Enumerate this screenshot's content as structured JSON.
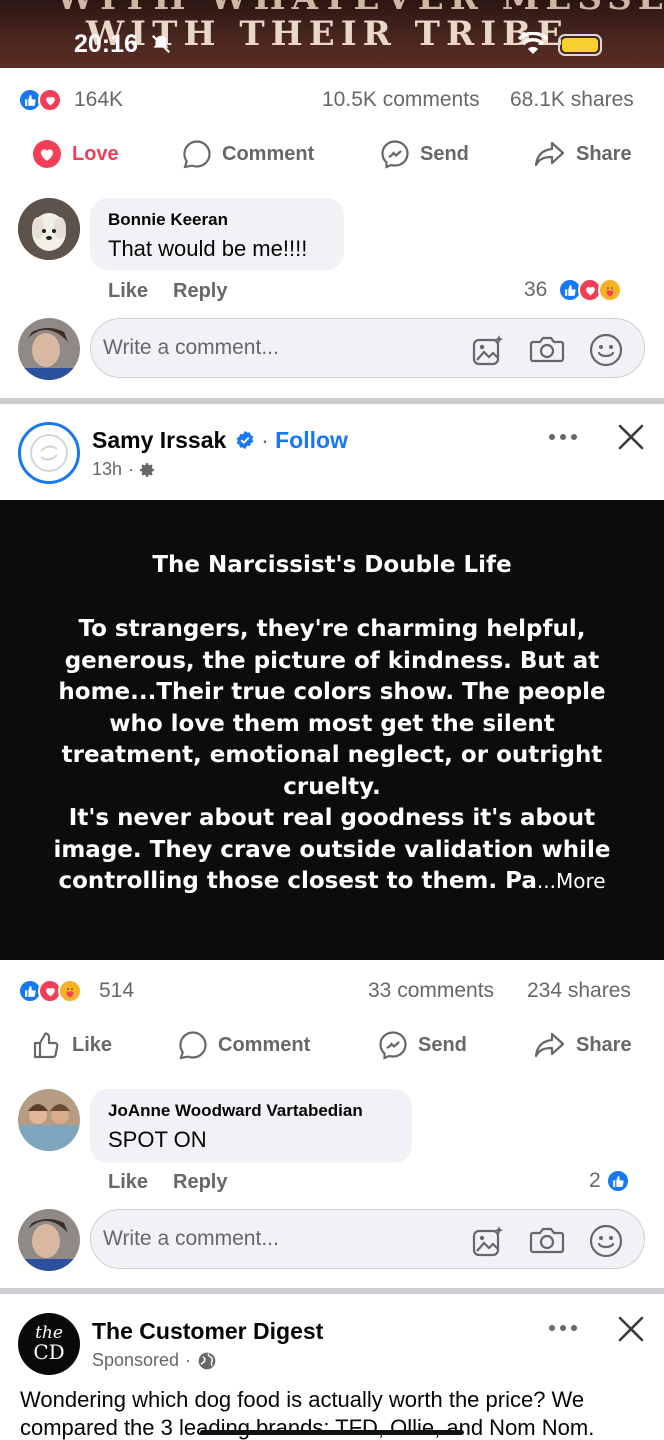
{
  "status_bar": {
    "time": "20:16",
    "background_text_line1": "WITH WHATEVER MESSES",
    "background_text_line2": "WITH THEIR TRIBE"
  },
  "post1": {
    "reaction_count": "164K",
    "comments": "10.5K comments",
    "shares": "68.1K shares",
    "actions": {
      "love": "Love",
      "comment": "Comment",
      "send": "Send",
      "share": "Share"
    },
    "top_comment": {
      "author": "Bonnie Keeran",
      "text": "That would be me!!!!",
      "like": "Like",
      "reply": "Reply",
      "reaction_count": "36"
    },
    "comment_placeholder": "Write a comment..."
  },
  "post2": {
    "author": "Samy Irssak",
    "follow": "Follow",
    "time": "13h",
    "separator": "·",
    "title": "The Narcissist's Double Life",
    "body": "To strangers, they're charming helpful, generous, the picture of kindness. But at home...Their true colors show. The people who love them most get the silent treatment, emotional neglect, or outright cruelty.\nIt's never about real goodness it's about image. They crave outside validation while controlling those closest to them. Pa",
    "more": "...More",
    "reaction_count": "514",
    "comments": "33 comments",
    "shares": "234 shares",
    "actions": {
      "like": "Like",
      "comment": "Comment",
      "send": "Send",
      "share": "Share"
    },
    "top_comment": {
      "author": "JoAnne Woodward Vartabedian",
      "text": "SPOT ON",
      "like": "Like",
      "reply": "Reply",
      "reaction_count": "2"
    },
    "comment_placeholder": "Write a comment..."
  },
  "post3": {
    "author": "The Customer Digest",
    "sponsored": "Sponsored",
    "logo_line1": "the",
    "logo_line2": "CD",
    "text": "Wondering which dog food is actually worth the price? We compared the 3 leading brands: TFD, Ollie, and Nom Nom."
  },
  "colors": {
    "facebook_blue": "#1877f2",
    "love_red": "#f33e58",
    "secondary_text": "#65676b",
    "divider": "#ccced2"
  },
  "icons": [
    "bell-slash-icon",
    "wifi-icon",
    "battery-icon",
    "heart-icon",
    "comment-icon",
    "messenger-icon",
    "share-icon",
    "thumbs-up-icon",
    "photo-sparkle-icon",
    "camera-icon",
    "smiley-icon",
    "verified-icon",
    "gear-icon",
    "globe-icon",
    "more-icon",
    "close-icon"
  ]
}
